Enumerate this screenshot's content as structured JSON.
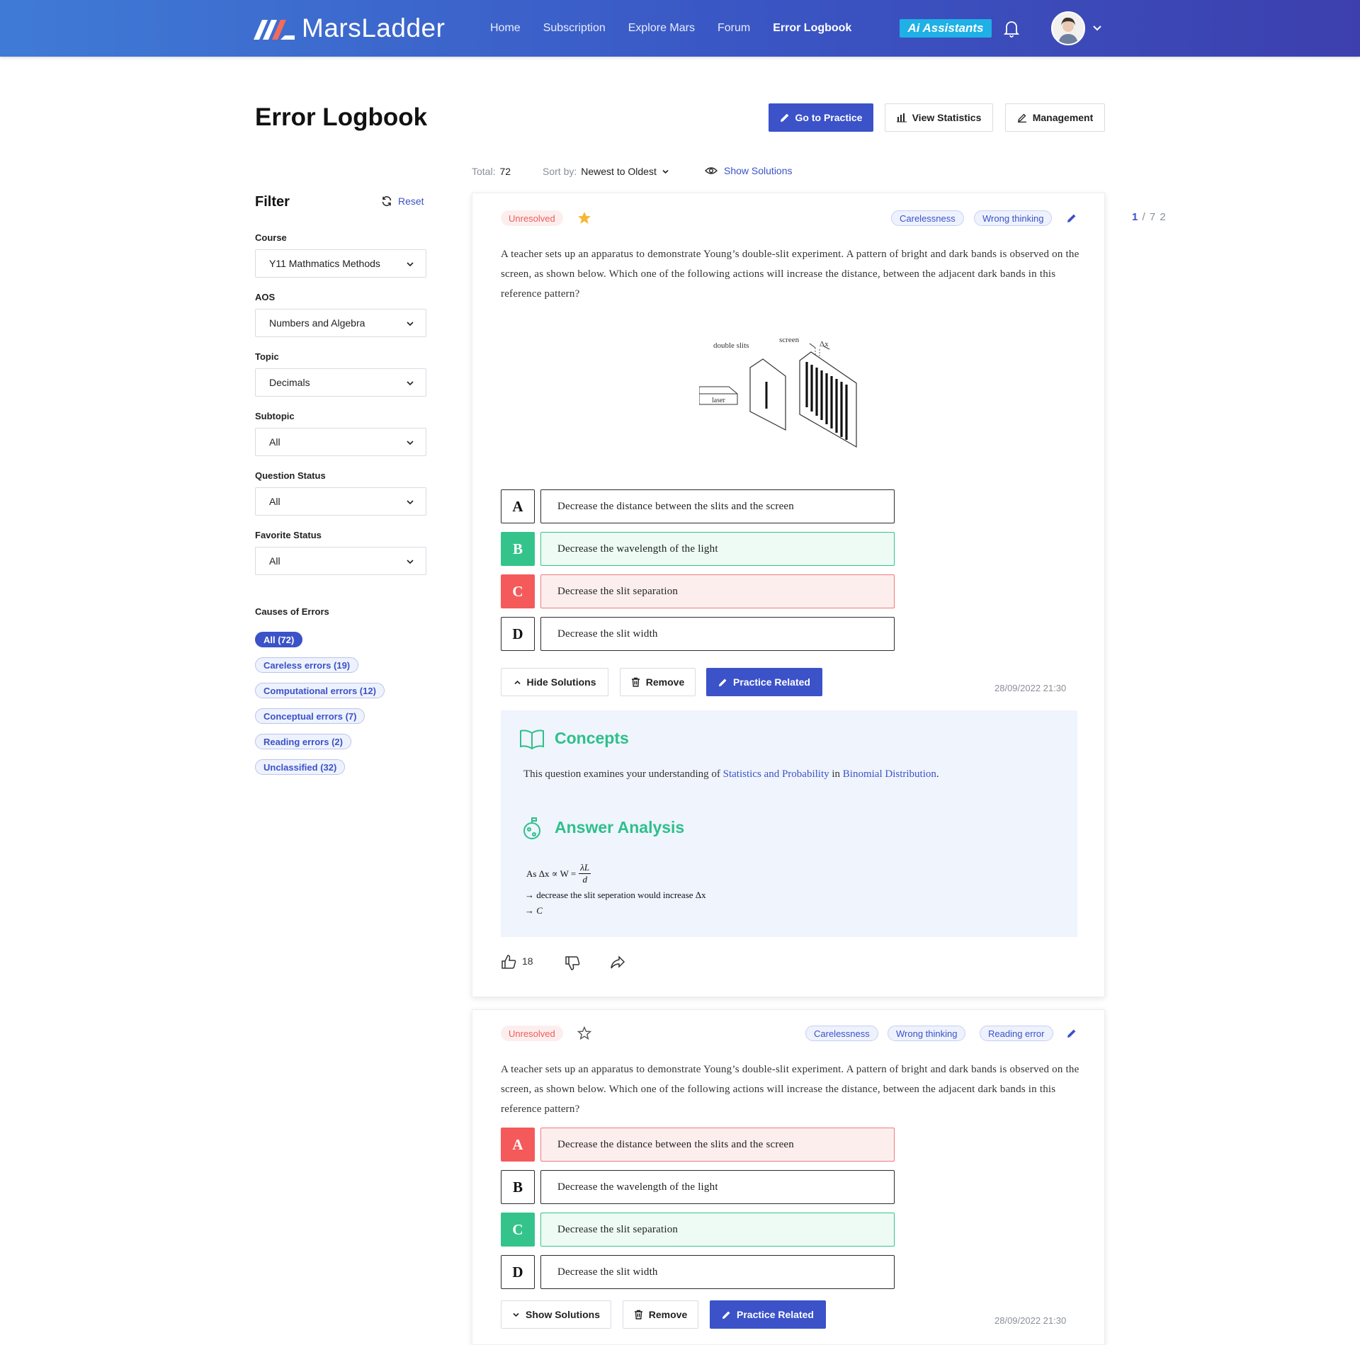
{
  "header": {
    "logo_text": "MarsLadder",
    "nav": [
      "Home",
      "Subscription",
      "Explore Mars",
      "Forum",
      "Error Logbook"
    ],
    "active_nav": "Error Logbook",
    "assistants_label": "Assistants",
    "assistants_ai": "Ai"
  },
  "page": {
    "title": "Error Logbook",
    "go_practice": "Go to Practice",
    "view_statistics": "View Statistics",
    "management": "Management"
  },
  "meta": {
    "total_label": "Total:",
    "total_value": "72",
    "sort_label": "Sort by:",
    "sort_value": "Newest to Oldest",
    "show_solutions": "Show Solutions"
  },
  "pager": {
    "current": "1",
    "total": "/ 7 2"
  },
  "filter": {
    "title": "Filter",
    "reset": "Reset",
    "course_label": "Course",
    "course_value": "Y11 Mathmatics Methods",
    "aos_label": "AOS",
    "aos_value": "Numbers and Algebra",
    "topic_label": "Topic",
    "topic_value": "Decimals",
    "subtopic_label": "Subtopic",
    "subtopic_value": "All",
    "status_label": "Question Status",
    "status_value": "All",
    "favorite_label": "Favorite Status",
    "favorite_value": "All",
    "causes_label": "Causes of Errors",
    "causes": [
      "All (72)",
      "Careless errors (19)",
      "Computational errors (12)",
      "Conceptual errors (7)",
      "Reading errors (2)",
      "Unclassified (32)"
    ]
  },
  "question_text": "A teacher sets up an apparatus to demonstrate Young’s double-slit experiment. A pattern of bright and dark bands is observed on the screen, as shown below. Which one of the following actions will increase the distance, between the adjacent dark bands in this reference pattern?",
  "diagram": {
    "slits": "double slits",
    "screen": "screen",
    "dx": "Δx",
    "laser": "laser"
  },
  "options": [
    {
      "letter": "A",
      "text": "Decrease the distance between the slits and the screen"
    },
    {
      "letter": "B",
      "text": "Decrease the wavelength of the light"
    },
    {
      "letter": "C",
      "text": "Decrease the slit separation"
    },
    {
      "letter": "D",
      "text": "Decrease the slit width"
    }
  ],
  "card1": {
    "status": "Unresolved",
    "tags": [
      "Carelessness",
      "Wrong thinking"
    ],
    "hide_solutions": "Hide Solutions",
    "remove": "Remove",
    "practice_related": "Practice Related",
    "date": "28/09/2022 21:30",
    "concepts_title": "Concepts",
    "concepts_pre": "This question examines your understanding of",
    "concepts_link1": "Statistics and Probability",
    "concepts_mid": "in",
    "concepts_link2": "Binomial Distribution",
    "concepts_end": ".",
    "analysis_title": "Answer Analysis",
    "analysis_line1_pre": "As Δx ∝ W =",
    "analysis_num": "λL",
    "analysis_den": "d",
    "analysis_line2": "→ decrease the slit seperation would increase Δx",
    "analysis_line3": "→ C",
    "likes": "18"
  },
  "card2": {
    "status": "Unresolved",
    "tags": [
      "Carelessness",
      "Wrong thinking",
      "Reading error"
    ],
    "show_solutions": "Show Solutions",
    "remove": "Remove",
    "practice_related": "Practice Related",
    "date": "28/09/2022 21:30"
  },
  "colors": {
    "primary": "#3b52c8",
    "correct": "#34c48b",
    "wrong": "#f45a5a",
    "concept_heading": "#2ec08a",
    "star": "#f7b731"
  }
}
